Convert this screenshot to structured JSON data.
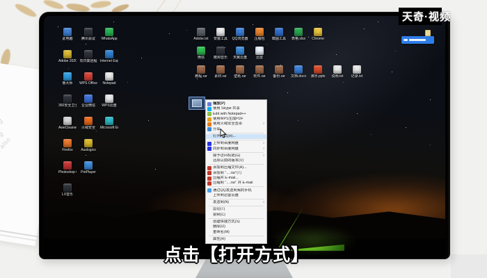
{
  "watermark": {
    "text": "天奇·视频"
  },
  "caption": {
    "text": "点击【打开方式】"
  },
  "scene": {
    "lines": [
      "thinking feeling",
      "like bringing",
      "product also"
    ]
  },
  "desktop": {
    "left_icon_rows": [
      [
        {
          "l": "此电脑",
          "c": "#3f7fd4"
        },
        {
          "l": "腾讯会议",
          "c": "#2d3138"
        },
        {
          "l": "WhatsApp",
          "c": "#25b450"
        }
      ],
      [
        {
          "l": "Adobe 2020",
          "c": "#d8b833"
        },
        {
          "l": "向日葵远程",
          "c": "#2d3138"
        },
        {
          "l": "Internet Explorer",
          "c": "#2f7fd0"
        }
      ],
      [
        {
          "l": "鲁大师",
          "c": "#2e9de0"
        },
        {
          "l": "WPS Office",
          "c": "#d23f35"
        },
        {
          "l": "Notepad",
          "c": "#e9e9e9"
        }
      ],
      [
        {
          "l": "360安全卫士",
          "c": "#2d3138"
        },
        {
          "l": "企业微信",
          "c": "#3a6fd8"
        },
        {
          "l": "WPS云盘",
          "c": "#e9e9e9"
        }
      ],
      [
        {
          "l": "AweCleaner",
          "c": "#d6d6d6"
        },
        {
          "l": "火绒安全",
          "c": "#e8681a"
        },
        {
          "l": "Microsoft Edge",
          "c": "#2bb8c4"
        }
      ],
      [
        {
          "l": "Firefox",
          "c": "#e87428"
        },
        {
          "l": "Auslogics",
          "c": "#d8b828"
        }
      ],
      [
        {
          "l": "Photoshop 6",
          "c": "#c63434"
        },
        {
          "l": "PotPlayer",
          "c": "#3a8ad8"
        }
      ],
      [
        {
          "l": "LX音乐",
          "c": "#2d3138"
        }
      ]
    ],
    "top_icon_rows": [
      [
        {
          "l": "Adobe.txt",
          "c": "#5a5f68"
        },
        {
          "l": "安装工具",
          "c": "#e9e9ec"
        },
        {
          "l": "QQ浏览器",
          "c": "#3a7fd8"
        },
        {
          "l": "压缩包",
          "c": "#e8842c"
        },
        {
          "l": "截图工具",
          "c": "#2f6fd0"
        },
        {
          "l": "表格.xlsx",
          "c": "#28a650"
        },
        {
          "l": "Chrome",
          "c": "#e8c33a"
        }
      ],
      [
        {
          "l": "微信",
          "c": "#2bbb4f"
        },
        {
          "l": "酷狗音乐",
          "c": "#2d3138"
        },
        {
          "l": "天翼云盘",
          "c": "#3a8ad8"
        },
        {
          "l": "迅雷",
          "c": "#e9f0f8"
        }
      ],
      [
        {
          "l": "教程.rar",
          "c": "#9a6647"
        },
        {
          "l": "素材.rar",
          "c": "#9a6647"
        },
        {
          "l": "壁纸.rar",
          "c": "#9a6647"
        },
        {
          "l": "软件.rar",
          "c": "#9a6647"
        },
        {
          "l": "备份.rar",
          "c": "#9a6647"
        },
        {
          "l": "文档.docx",
          "c": "#3a7fd8"
        },
        {
          "l": "演示.pptx",
          "c": "#d84a2a"
        },
        {
          "l": "说明.txt",
          "c": "#e9e9e9"
        },
        {
          "l": "记录.txt",
          "c": "#e9e9e9"
        }
      ]
    ]
  },
  "context_menu": {
    "items": [
      {
        "t": "item",
        "l": "播放(P)",
        "c": "#6a7fd8",
        "b": true
      },
      {
        "t": "item",
        "l": "使用 Skype 共享",
        "c": "#00aff0"
      },
      {
        "t": "item",
        "l": "Edit with Notepad++",
        "c": "#8ac240"
      },
      {
        "t": "item",
        "l": "使用WPS生成PDF",
        "c": "#e8a01a"
      },
      {
        "t": "item",
        "l": "使用火绒安全查杀",
        "c": "#e87a1a",
        "a": true
      },
      {
        "t": "item",
        "l": "分享",
        "c": "#3a8ad8"
      },
      {
        "t": "sep"
      },
      {
        "t": "item",
        "l": "打开方式(H)...",
        "h": true
      },
      {
        "t": "sep"
      },
      {
        "t": "item",
        "l": "上传到百度网盘",
        "c": "#2932e1",
        "a": true
      },
      {
        "t": "item",
        "l": "同步到百度网盘",
        "c": "#2932e1",
        "a": true
      },
      {
        "t": "sep"
      },
      {
        "t": "item",
        "l": "授予访问权限(G)",
        "a": true
      },
      {
        "t": "item",
        "l": "还原以前的版本(V)"
      },
      {
        "t": "sep"
      },
      {
        "t": "item",
        "l": "添加到压缩文件(A)...",
        "c": "#c0392b"
      },
      {
        "t": "item",
        "l": "添加到 \"….rar\"(T)",
        "c": "#c0392b"
      },
      {
        "t": "item",
        "l": "压缩并 E-mail...",
        "c": "#c0392b"
      },
      {
        "t": "item",
        "l": "压缩到 \"….rar\" 并 E-mail",
        "c": "#c0392b"
      },
      {
        "t": "sep"
      },
      {
        "t": "item",
        "l": "通过QQ发送到我的手机",
        "c": "#4aa0e8"
      },
      {
        "t": "item",
        "l": "上传到迅雷云盘"
      },
      {
        "t": "sep"
      },
      {
        "t": "item",
        "l": "发送到(N)",
        "a": true
      },
      {
        "t": "sep"
      },
      {
        "t": "item",
        "l": "剪切(T)"
      },
      {
        "t": "item",
        "l": "复制(C)"
      },
      {
        "t": "sep"
      },
      {
        "t": "item",
        "l": "创建快捷方式(S)"
      },
      {
        "t": "item",
        "l": "删除(D)"
      },
      {
        "t": "item",
        "l": "重命名(M)"
      },
      {
        "t": "sep"
      },
      {
        "t": "item",
        "l": "属性(R)"
      }
    ]
  }
}
